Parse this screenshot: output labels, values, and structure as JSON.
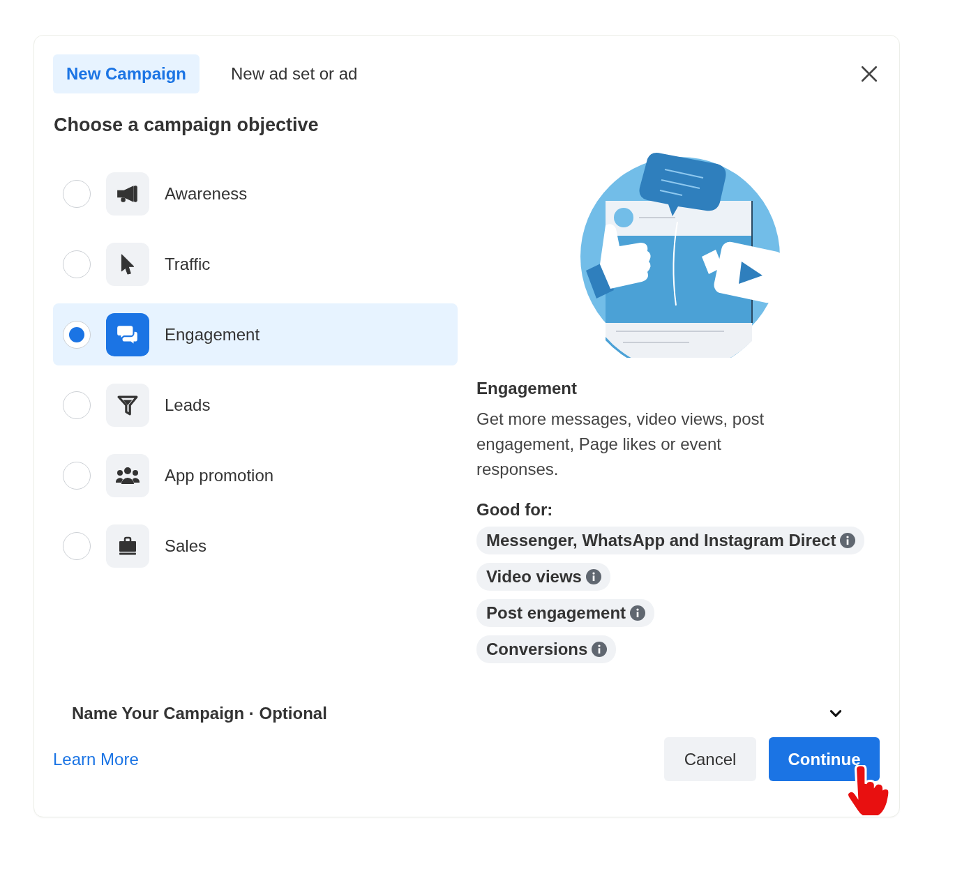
{
  "tabs": [
    {
      "label": "New Campaign",
      "selected": true
    },
    {
      "label": "New ad set or ad",
      "selected": false
    }
  ],
  "heading": "Choose a campaign objective",
  "objectives": [
    {
      "label": "Awareness",
      "selected": false
    },
    {
      "label": "Traffic",
      "selected": false
    },
    {
      "label": "Engagement",
      "selected": true
    },
    {
      "label": "Leads",
      "selected": false
    },
    {
      "label": "App promotion",
      "selected": false
    },
    {
      "label": "Sales",
      "selected": false
    }
  ],
  "detail": {
    "title": "Engagement",
    "description": "Get more messages, video views, post engagement, Page likes or event responses.",
    "good_for_label": "Good for:",
    "good_for": [
      "Messenger, WhatsApp and Instagram Direct",
      "Video views",
      "Post engagement",
      "Conversions"
    ]
  },
  "name_section": {
    "label": "Name Your Campaign · Optional",
    "expanded": false
  },
  "learn_more": "Learn More",
  "buttons": {
    "cancel": "Cancel",
    "continue": "Continue"
  }
}
